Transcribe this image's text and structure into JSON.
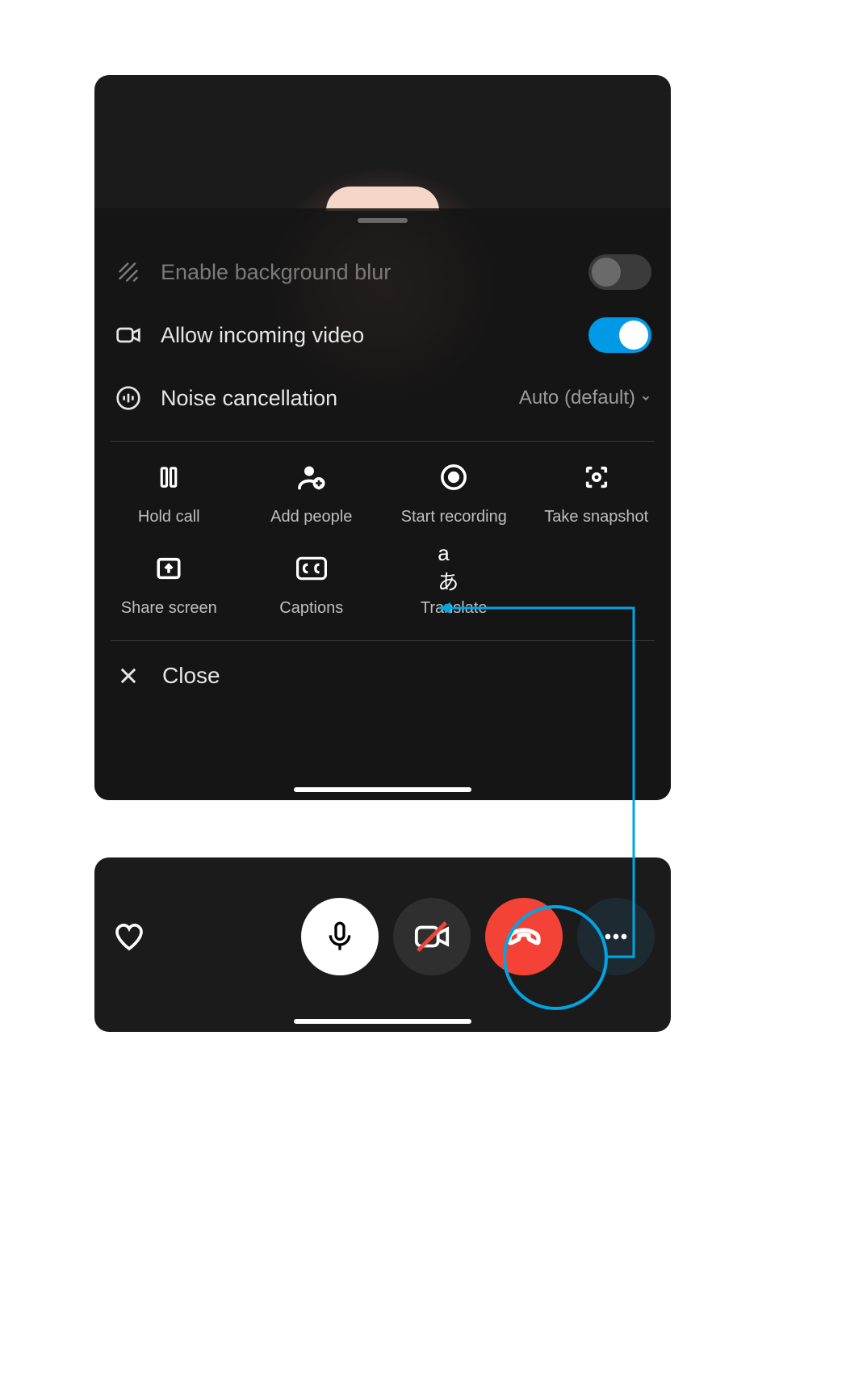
{
  "settings": {
    "blur": {
      "label": "Enable background blur",
      "on": false
    },
    "video": {
      "label": "Allow incoming video",
      "on": true
    },
    "noise": {
      "label": "Noise cancellation",
      "value": "Auto (default)"
    }
  },
  "actions": {
    "hold": "Hold call",
    "add": "Add people",
    "record": "Start recording",
    "snapshot": "Take snapshot",
    "share": "Share screen",
    "captions": "Captions",
    "translate": "Translate"
  },
  "close_label": "Close",
  "translate_glyph": "aあ"
}
